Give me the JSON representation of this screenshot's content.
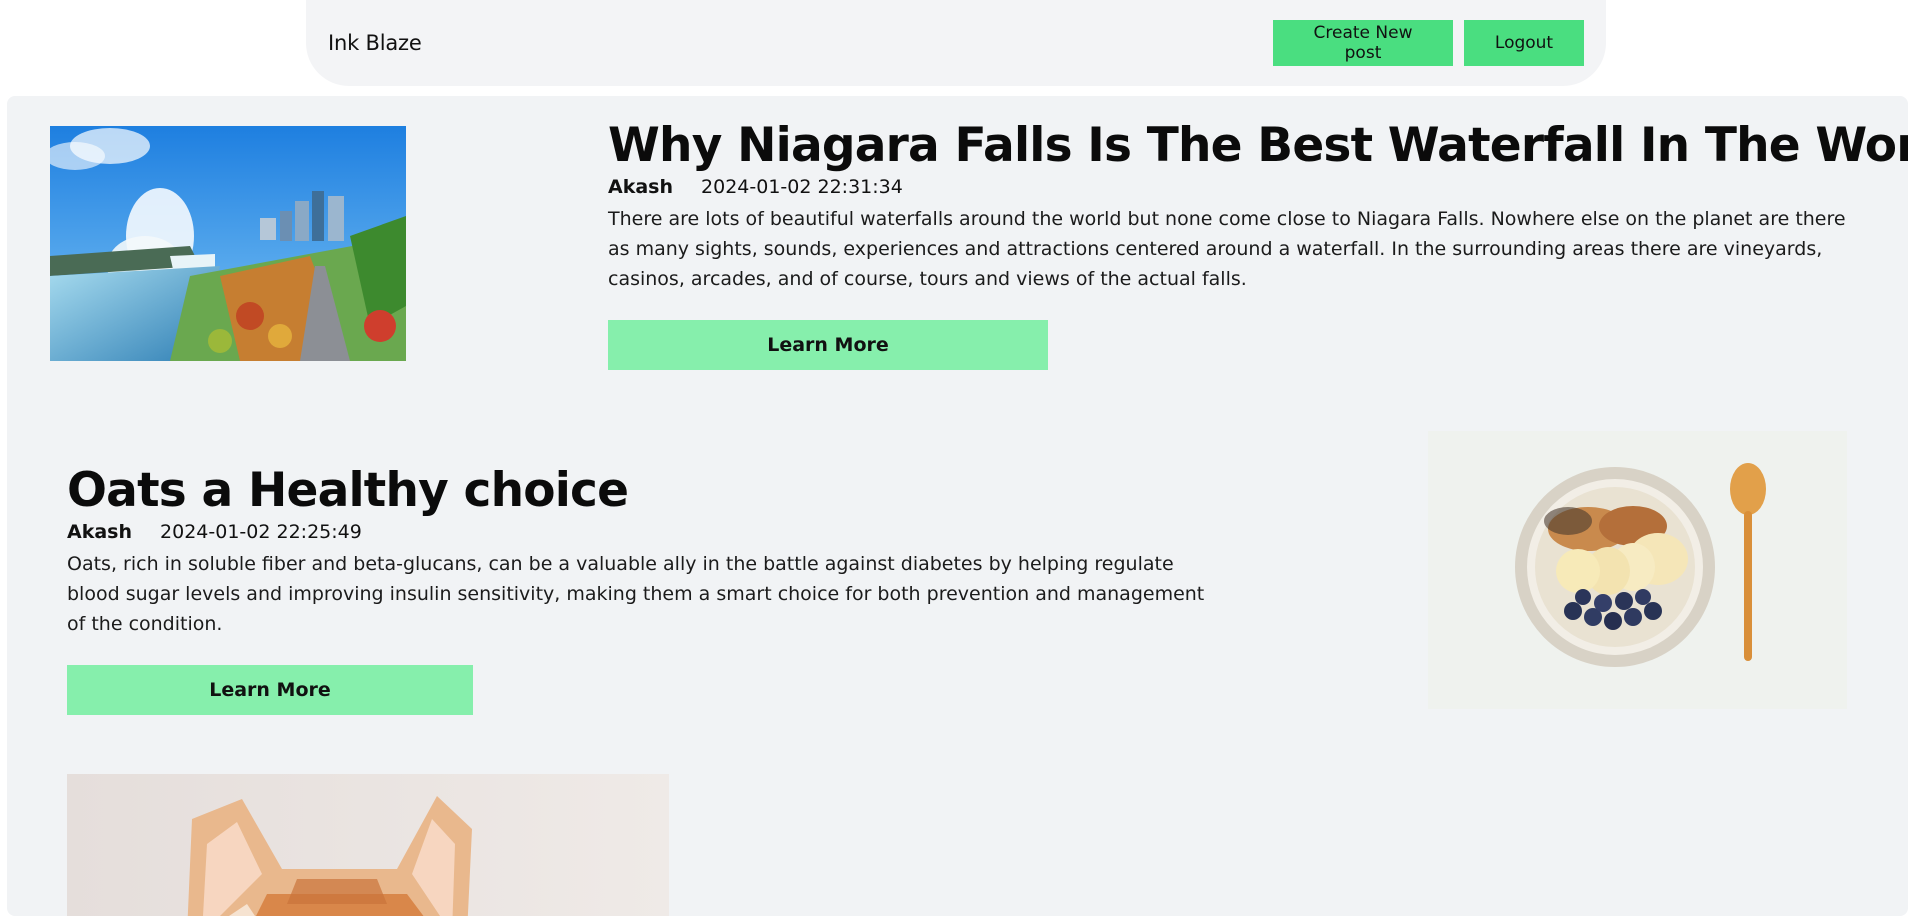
{
  "header": {
    "brand": "Ink Blaze",
    "create_label": "Create New post",
    "logout_label": "Logout"
  },
  "posts": [
    {
      "title": "Why Niagara Falls Is The Best Waterfall In The World.",
      "author": "Akash",
      "date": "2024-01-02 22:31:34",
      "body": "There are lots of beautiful waterfalls around the world but none come close to Niagara Falls. Nowhere else on the planet are there as many sights, sounds, experiences and attractions centered around a waterfall. In the surrounding areas there are vineyards, casinos, arcades, and of course, tours and views of the actual falls.",
      "button": "Learn More"
    },
    {
      "title": "Oats a Healthy choice",
      "author": "Akash",
      "date": "2024-01-02 22:25:49",
      "body": "Oats, rich in soluble fiber and beta-glucans, can be a valuable ally in the battle against diabetes by helping regulate blood sugar levels and improving insulin sensitivity, making them a smart choice for both prevention and management of the condition.",
      "button": "Learn More"
    }
  ],
  "colors": {
    "button_primary": "#4ade80",
    "button_learn": "#86efac",
    "panel_bg": "#f1f3f5",
    "header_bg": "#f3f4f6"
  },
  "icons": {
    "post_1_image": "niagara-falls-photo",
    "post_2_image": "oats-bowl-photo",
    "post_3_image": "kitten-photo"
  }
}
